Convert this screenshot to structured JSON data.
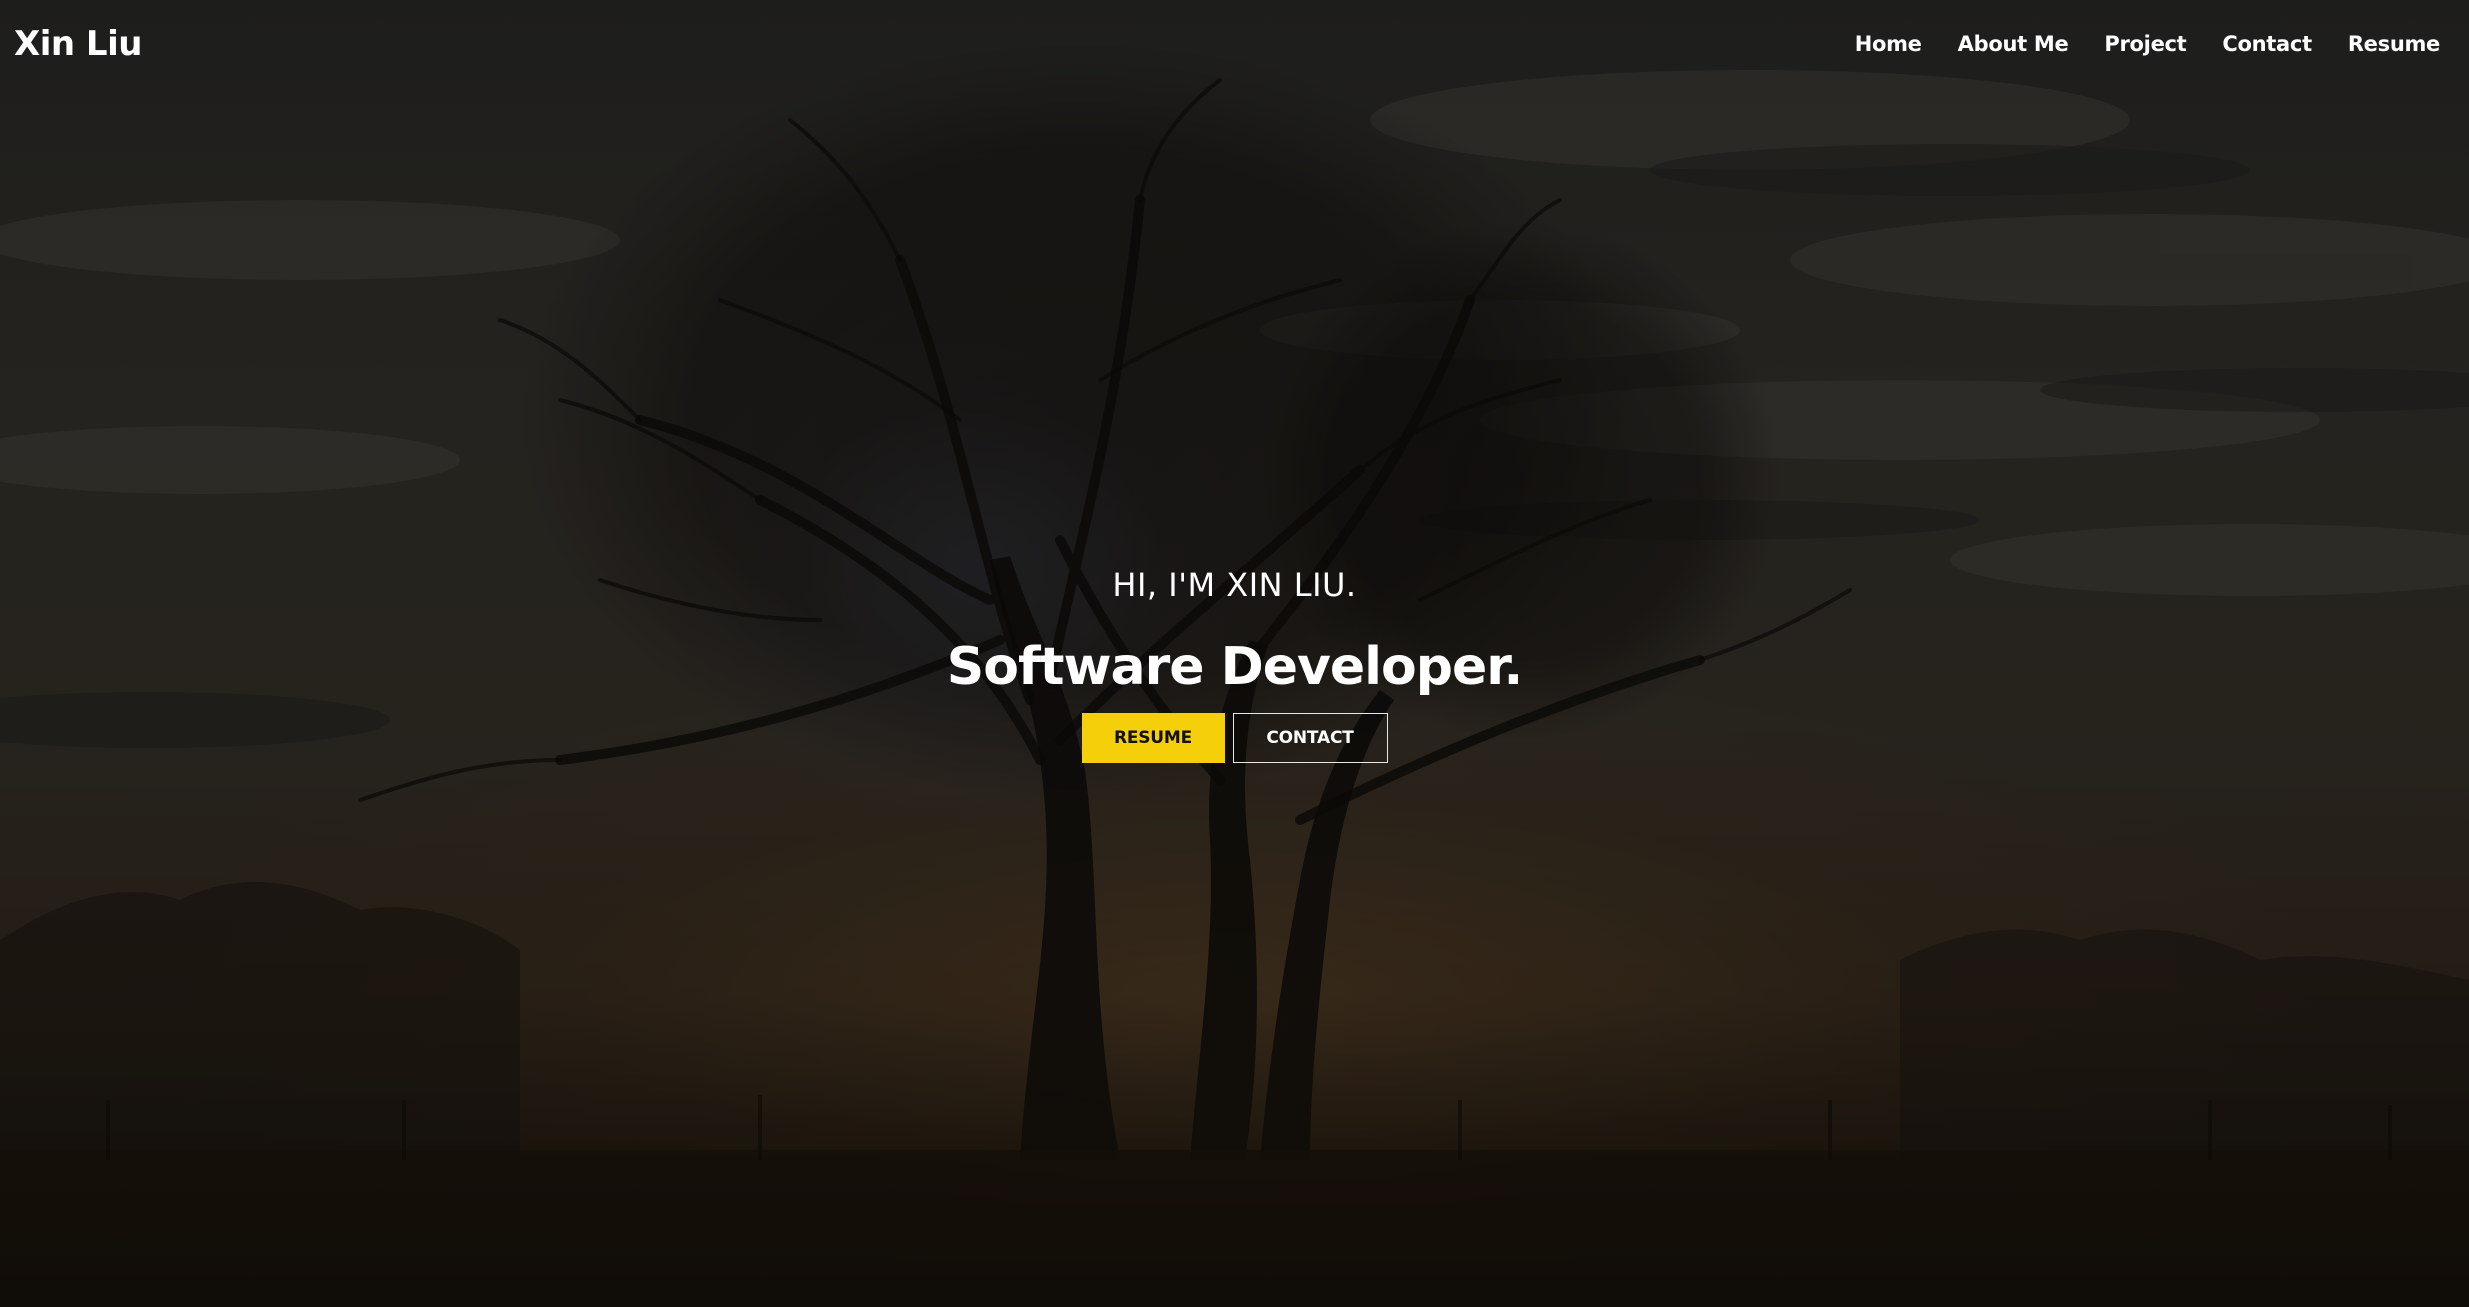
{
  "brand": "Xin Liu",
  "nav": {
    "items": [
      {
        "label": "Home"
      },
      {
        "label": "About Me"
      },
      {
        "label": "Project"
      },
      {
        "label": "Contact"
      },
      {
        "label": "Resume"
      }
    ]
  },
  "hero": {
    "greeting": "HI, I'M XIN LIU.",
    "headline": "Software Developer.",
    "buttons": {
      "resume": "RESUME",
      "contact": "CONTACT"
    },
    "background_image": "silhouetted tree against misty sunset sky"
  },
  "colors": {
    "accent": "#f5d00a",
    "text": "#ffffff"
  }
}
